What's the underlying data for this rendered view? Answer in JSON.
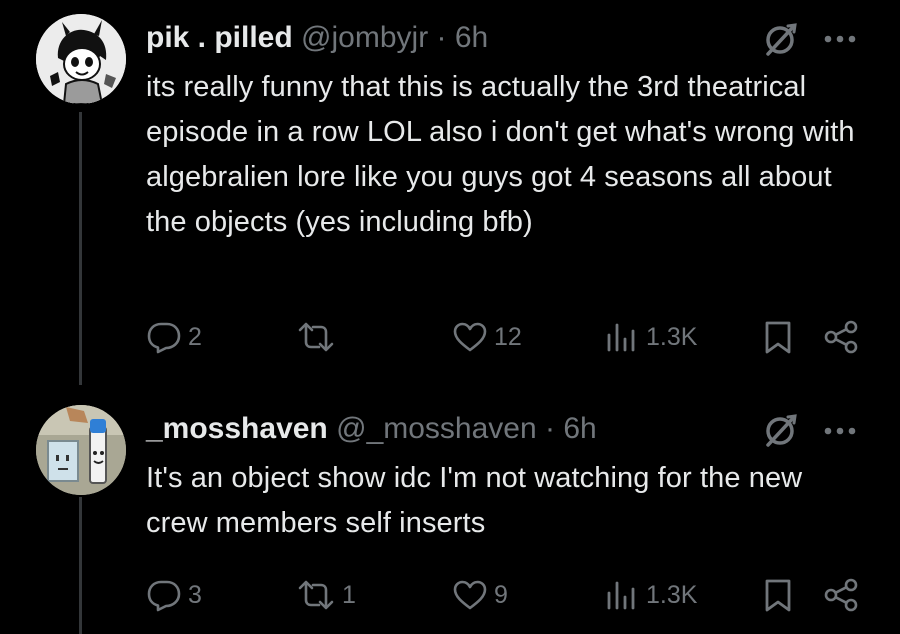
{
  "tweets": [
    {
      "display_name": "pik . pilled",
      "handle": "@jombyjr",
      "separator": "·",
      "time": "6h",
      "text": "its really funny that this is actually the 3rd theatrical episode in a row LOL also i don't get what's wrong with algebralien lore like you guys got 4 seasons all about the objects (yes including bfb)",
      "replies": "2",
      "retweets": "",
      "likes": "12",
      "views": "1.3K"
    },
    {
      "display_name": "_mosshaven",
      "handle": "@_mosshaven",
      "separator": "·",
      "time": "6h",
      "text": "It's an object show idc I'm not watching for the new crew members self inserts",
      "replies": "3",
      "retweets": "1",
      "likes": "9",
      "views": "1.3K"
    }
  ],
  "icons": {
    "reply": "reply-icon",
    "retweet": "retweet-icon",
    "like": "heart-icon",
    "views": "views-icon",
    "bookmark": "bookmark-icon",
    "share": "share-icon",
    "grok": "grok-icon",
    "more": "more-icon"
  },
  "colors": {
    "background": "#000000",
    "primary_text": "#e7e9ea",
    "secondary_text": "#71767b",
    "thread_line": "#333639"
  }
}
